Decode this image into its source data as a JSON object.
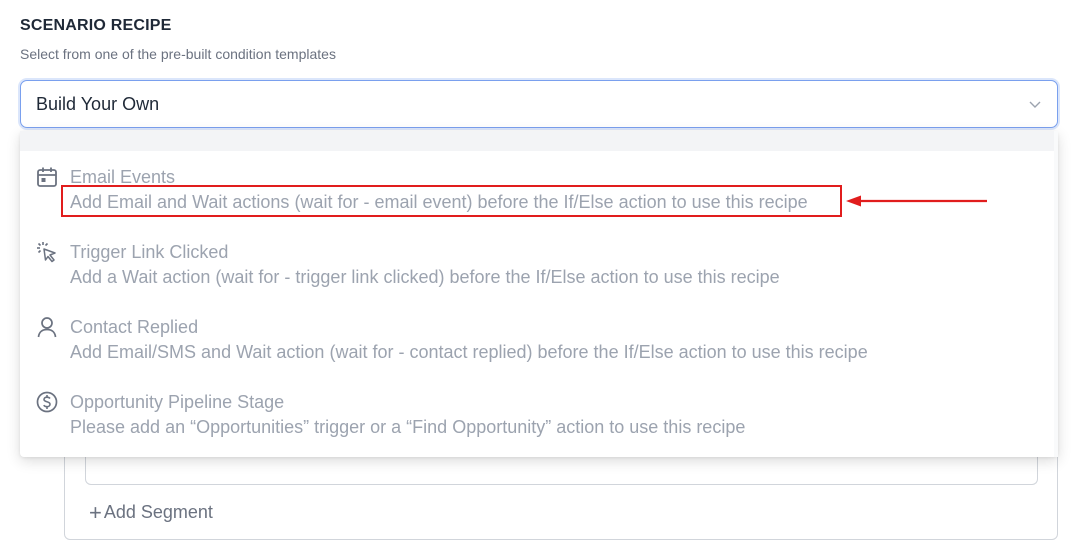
{
  "section": {
    "title": "SCENARIO RECIPE",
    "subtitle": "Select from one of the pre-built condition templates"
  },
  "select": {
    "value": "Build Your Own",
    "chevron_icon": "chevron-down-icon"
  },
  "options": [
    {
      "icon": "calendar-icon",
      "title": "Email Events",
      "description": "Add Email and Wait actions (wait for - email event) before the If/Else action to use this recipe"
    },
    {
      "icon": "pointer-click-icon",
      "title": "Trigger Link Clicked",
      "description": "Add a Wait action (wait for - trigger link clicked) before the If/Else action to use this recipe"
    },
    {
      "icon": "user-icon",
      "title": "Contact Replied",
      "description": "Add Email/SMS and Wait action (wait for - contact replied) before the If/Else action to use this recipe"
    },
    {
      "icon": "dollar-circle-icon",
      "title": "Opportunity Pipeline Stage",
      "description": "Please add an “Opportunities” trigger or a “Find Opportunity” action to use this recipe"
    }
  ],
  "segment": {
    "add_label": "Add Segment",
    "plus_symbol": "+"
  },
  "annotation": {
    "highlight_color": "#e11d1d"
  }
}
